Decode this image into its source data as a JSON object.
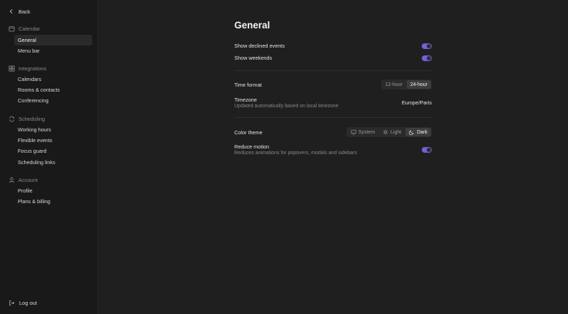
{
  "sidebar": {
    "back_label": "Back",
    "sections": [
      {
        "title": "Calendar",
        "icon": "calendar-icon",
        "items": [
          {
            "label": "General",
            "active": true
          },
          {
            "label": "Menu bar"
          }
        ]
      },
      {
        "title": "Integrations",
        "icon": "grid-icon",
        "items": [
          {
            "label": "Calendars"
          },
          {
            "label": "Rooms & contacts"
          },
          {
            "label": "Conferencing"
          }
        ]
      },
      {
        "title": "Scheduling",
        "icon": "repeat-icon",
        "items": [
          {
            "label": "Working hours"
          },
          {
            "label": "Flexible events"
          },
          {
            "label": "Focus guard"
          },
          {
            "label": "Scheduling links"
          }
        ]
      },
      {
        "title": "Account",
        "icon": "user-icon",
        "items": [
          {
            "label": "Profile"
          },
          {
            "label": "Plans & billing"
          }
        ]
      }
    ],
    "logout_label": "Log out"
  },
  "main": {
    "title": "General",
    "show_declined_label": "Show declined events",
    "show_declined_on": true,
    "show_weekends_label": "Show weekends",
    "show_weekends_on": true,
    "time_format_label": "Time format",
    "time_format_options": [
      "12-hour",
      "24-hour"
    ],
    "time_format_selected": "24-hour",
    "timezone_label": "Timezone",
    "timezone_sub": "Updated automatically based on local timezone",
    "timezone_value": "Europe/Paris",
    "color_theme_label": "Color theme",
    "color_theme_options": [
      "System",
      "Light",
      "Dark"
    ],
    "color_theme_selected": "Dark",
    "reduce_motion_label": "Reduce motion",
    "reduce_motion_sub": "Reduces animations for popovers, modals and sidebars",
    "reduce_motion_on": true
  },
  "colors": {
    "accent": "#7361d6",
    "background": "#1f1f1f",
    "sidebar": "#191919"
  }
}
